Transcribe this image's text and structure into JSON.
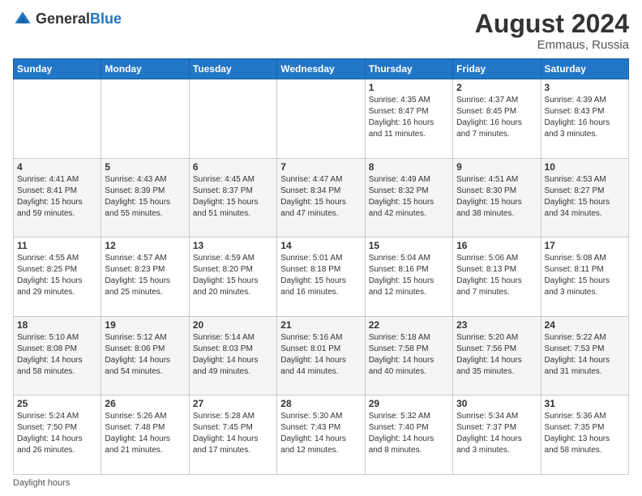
{
  "header": {
    "logo_general": "General",
    "logo_blue": "Blue",
    "month_year": "August 2024",
    "location": "Emmaus, Russia"
  },
  "days_of_week": [
    "Sunday",
    "Monday",
    "Tuesday",
    "Wednesday",
    "Thursday",
    "Friday",
    "Saturday"
  ],
  "footer": {
    "note": "Daylight hours"
  },
  "weeks": [
    {
      "cells": [
        {
          "empty": true
        },
        {
          "empty": true
        },
        {
          "empty": true
        },
        {
          "empty": true
        },
        {
          "day": 1,
          "sunrise": "4:35 AM",
          "sunset": "8:47 PM",
          "daylight": "16 hours and 11 minutes."
        },
        {
          "day": 2,
          "sunrise": "4:37 AM",
          "sunset": "8:45 PM",
          "daylight": "16 hours and 7 minutes."
        },
        {
          "day": 3,
          "sunrise": "4:39 AM",
          "sunset": "8:43 PM",
          "daylight": "16 hours and 3 minutes."
        }
      ]
    },
    {
      "cells": [
        {
          "day": 4,
          "sunrise": "4:41 AM",
          "sunset": "8:41 PM",
          "daylight": "15 hours and 59 minutes."
        },
        {
          "day": 5,
          "sunrise": "4:43 AM",
          "sunset": "8:39 PM",
          "daylight": "15 hours and 55 minutes."
        },
        {
          "day": 6,
          "sunrise": "4:45 AM",
          "sunset": "8:37 PM",
          "daylight": "15 hours and 51 minutes."
        },
        {
          "day": 7,
          "sunrise": "4:47 AM",
          "sunset": "8:34 PM",
          "daylight": "15 hours and 47 minutes."
        },
        {
          "day": 8,
          "sunrise": "4:49 AM",
          "sunset": "8:32 PM",
          "daylight": "15 hours and 42 minutes."
        },
        {
          "day": 9,
          "sunrise": "4:51 AM",
          "sunset": "8:30 PM",
          "daylight": "15 hours and 38 minutes."
        },
        {
          "day": 10,
          "sunrise": "4:53 AM",
          "sunset": "8:27 PM",
          "daylight": "15 hours and 34 minutes."
        }
      ]
    },
    {
      "cells": [
        {
          "day": 11,
          "sunrise": "4:55 AM",
          "sunset": "8:25 PM",
          "daylight": "15 hours and 29 minutes."
        },
        {
          "day": 12,
          "sunrise": "4:57 AM",
          "sunset": "8:23 PM",
          "daylight": "15 hours and 25 minutes."
        },
        {
          "day": 13,
          "sunrise": "4:59 AM",
          "sunset": "8:20 PM",
          "daylight": "15 hours and 20 minutes."
        },
        {
          "day": 14,
          "sunrise": "5:01 AM",
          "sunset": "8:18 PM",
          "daylight": "15 hours and 16 minutes."
        },
        {
          "day": 15,
          "sunrise": "5:04 AM",
          "sunset": "8:16 PM",
          "daylight": "15 hours and 12 minutes."
        },
        {
          "day": 16,
          "sunrise": "5:06 AM",
          "sunset": "8:13 PM",
          "daylight": "15 hours and 7 minutes."
        },
        {
          "day": 17,
          "sunrise": "5:08 AM",
          "sunset": "8:11 PM",
          "daylight": "15 hours and 3 minutes."
        }
      ]
    },
    {
      "cells": [
        {
          "day": 18,
          "sunrise": "5:10 AM",
          "sunset": "8:08 PM",
          "daylight": "14 hours and 58 minutes."
        },
        {
          "day": 19,
          "sunrise": "5:12 AM",
          "sunset": "8:06 PM",
          "daylight": "14 hours and 54 minutes."
        },
        {
          "day": 20,
          "sunrise": "5:14 AM",
          "sunset": "8:03 PM",
          "daylight": "14 hours and 49 minutes."
        },
        {
          "day": 21,
          "sunrise": "5:16 AM",
          "sunset": "8:01 PM",
          "daylight": "14 hours and 44 minutes."
        },
        {
          "day": 22,
          "sunrise": "5:18 AM",
          "sunset": "7:58 PM",
          "daylight": "14 hours and 40 minutes."
        },
        {
          "day": 23,
          "sunrise": "5:20 AM",
          "sunset": "7:56 PM",
          "daylight": "14 hours and 35 minutes."
        },
        {
          "day": 24,
          "sunrise": "5:22 AM",
          "sunset": "7:53 PM",
          "daylight": "14 hours and 31 minutes."
        }
      ]
    },
    {
      "cells": [
        {
          "day": 25,
          "sunrise": "5:24 AM",
          "sunset": "7:50 PM",
          "daylight": "14 hours and 26 minutes."
        },
        {
          "day": 26,
          "sunrise": "5:26 AM",
          "sunset": "7:48 PM",
          "daylight": "14 hours and 21 minutes."
        },
        {
          "day": 27,
          "sunrise": "5:28 AM",
          "sunset": "7:45 PM",
          "daylight": "14 hours and 17 minutes."
        },
        {
          "day": 28,
          "sunrise": "5:30 AM",
          "sunset": "7:43 PM",
          "daylight": "14 hours and 12 minutes."
        },
        {
          "day": 29,
          "sunrise": "5:32 AM",
          "sunset": "7:40 PM",
          "daylight": "14 hours and 8 minutes."
        },
        {
          "day": 30,
          "sunrise": "5:34 AM",
          "sunset": "7:37 PM",
          "daylight": "14 hours and 3 minutes."
        },
        {
          "day": 31,
          "sunrise": "5:36 AM",
          "sunset": "7:35 PM",
          "daylight": "13 hours and 58 minutes."
        }
      ]
    }
  ]
}
